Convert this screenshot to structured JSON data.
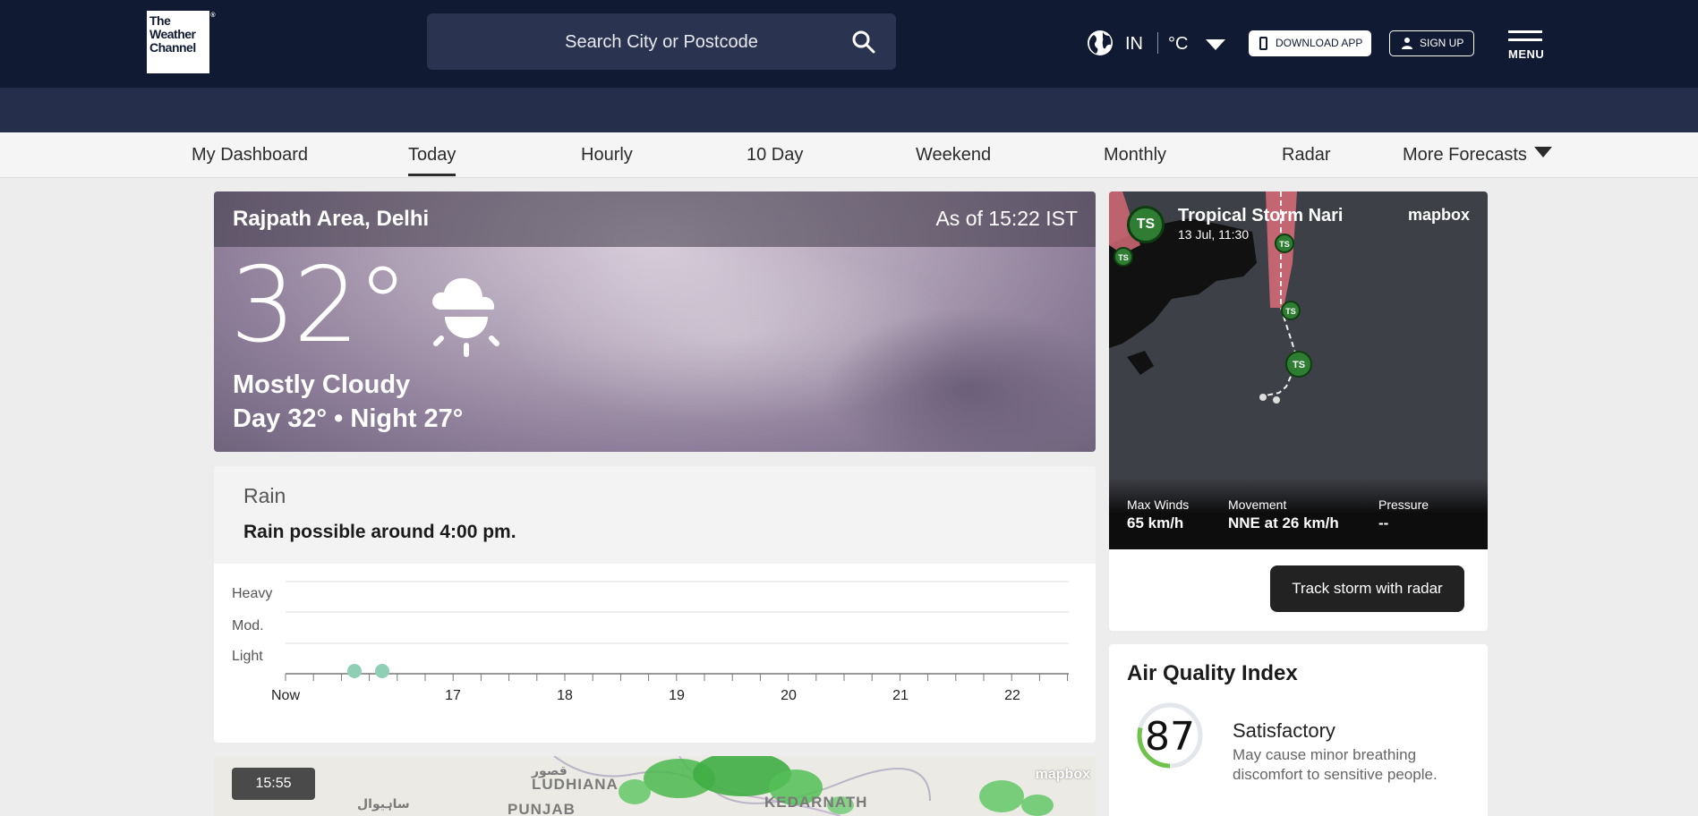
{
  "header": {
    "logo": {
      "line1": "The",
      "line2": "Weather",
      "line3": "Channel",
      "mark": "®"
    },
    "search_placeholder": "Search City or Postcode",
    "icons": {
      "search": "search-icon",
      "globe": "globe-icon",
      "phone": "phone-icon",
      "user": "user-icon",
      "menu": "hamburger-icon"
    },
    "locale": "IN",
    "unit": "°C",
    "download_label": "Download App",
    "signup_label": "Sign Up",
    "menu_label": "MENU",
    "colors": {
      "topbar": "#111a33",
      "subbar": "#252f4b"
    }
  },
  "nav": {
    "tabs": [
      {
        "label": "My Dashboard",
        "active": false
      },
      {
        "label": "Today",
        "active": true
      },
      {
        "label": "Hourly",
        "active": false
      },
      {
        "label": "10 Day",
        "active": false
      },
      {
        "label": "Weekend",
        "active": false
      },
      {
        "label": "Monthly",
        "active": false
      },
      {
        "label": "Radar",
        "active": false
      },
      {
        "label": "More Forecasts",
        "active": false
      }
    ]
  },
  "current": {
    "location": "Rajpath Area, Delhi",
    "as_of": "As of 15:22 IST",
    "temperature": "32°",
    "condition": "Mostly Cloudy",
    "day_night": "Day 32° • Night 27°",
    "icon": "partly-cloudy-day-icon"
  },
  "rain": {
    "title": "Rain",
    "message": "Rain possible around 4:00 pm.",
    "levels": [
      "Heavy",
      "Mod.",
      "Light"
    ],
    "x_labels": [
      "Now",
      "17",
      "18",
      "19",
      "20",
      "21",
      "22"
    ],
    "dot_color": "#8fcfb5"
  },
  "map_preview": {
    "time": "15:55",
    "attribution": "mapbox",
    "labels": [
      "LUDHIANA",
      "PUNJAB",
      "KEDARNATH",
      "قصور",
      "ساہیوال"
    ]
  },
  "storm": {
    "badge": "TS",
    "name": "Tropical Storm Nari",
    "date": "13 Jul, 11:30",
    "attribution": "mapbox",
    "stats": [
      {
        "label": "Max Winds",
        "value": "65 km/h"
      },
      {
        "label": "Movement",
        "value": "NNE at 26 km/h"
      },
      {
        "label": "Pressure",
        "value": "--"
      }
    ],
    "track_button": "Track storm with radar",
    "track_markers": [
      "TS",
      "TS",
      "TS",
      "TS"
    ],
    "colors": {
      "badge": "#2e7d32",
      "track": "#e0707c"
    }
  },
  "aqi": {
    "title": "Air Quality Index",
    "value": "87",
    "category": "Satisfactory",
    "description": "May cause minor breathing discomfort to sensitive people.",
    "level_fraction": 0.29,
    "color": "#6fc24c"
  }
}
